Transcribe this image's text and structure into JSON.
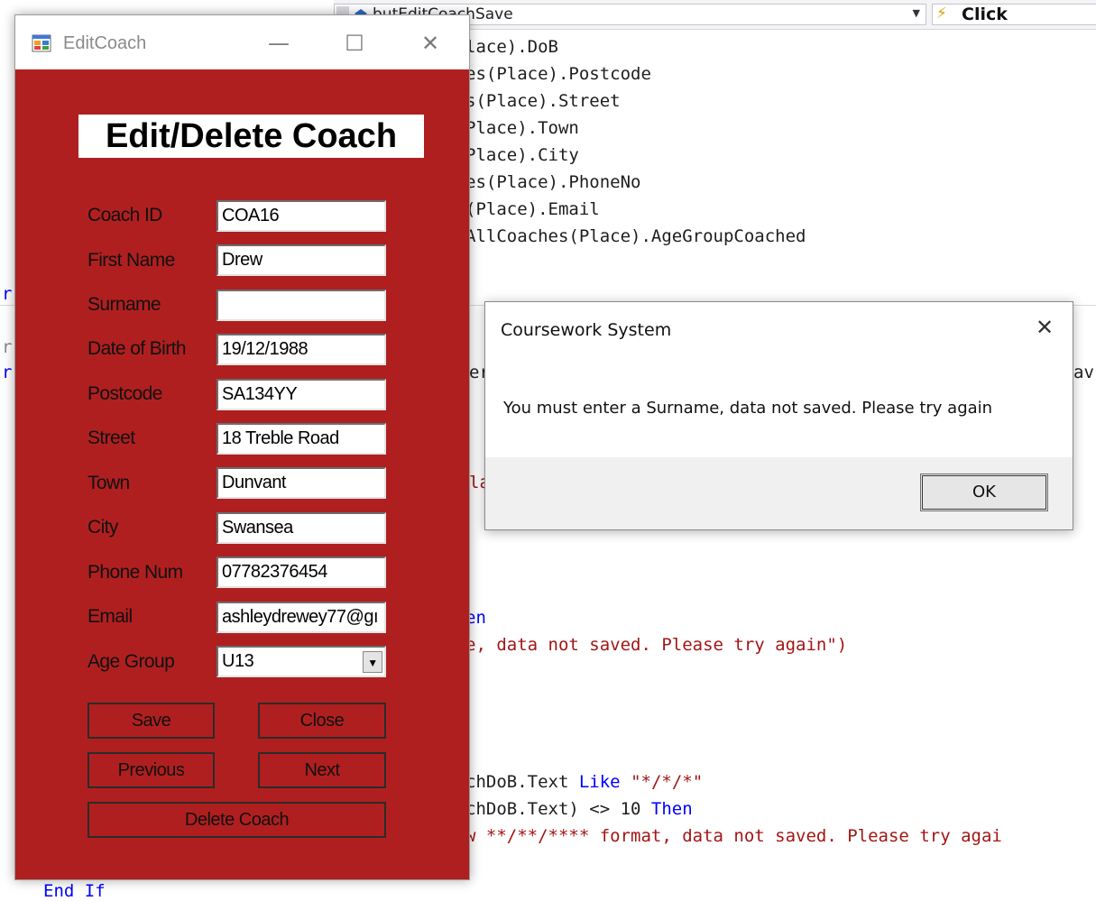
{
  "ide": {
    "method_combo": "butEditCoachSave",
    "event_combo": "Click",
    "code_lines_top": [
      "lace).DoB",
      "es(Place).Postcode",
      "s(Place).Street",
      "Place).Town",
      "Place).City",
      "es(Place).PhoneNo",
      "(Place).Email",
      "AllCoaches(Place).AgeGroupCoached"
    ],
    "code_fragments": {
      "left_r1": "r",
      "left_r2": "r",
      "left_r3": "r",
      "er": "er",
      "av": "av",
      "la": "la",
      "then_fragment": "en",
      "surname_msg_line": "e, data not saved. Please try again\")",
      "like_line_prefix": "chDoB.Text ",
      "like_kw": "Like",
      "like_str": "\"*/*/*\"",
      "len_line_prefix": "chDoB.Text) <> 10 ",
      "then_kw": "Then",
      "format_msg_line": "w **/**/**** format, data not saved. Please try agai",
      "end_if": "End If"
    }
  },
  "edit_coach": {
    "window_title": "EditCoach",
    "heading": "Edit/Delete Coach",
    "fields": {
      "coach_id": {
        "label": "Coach ID",
        "value": "COA16"
      },
      "first_name": {
        "label": "First Name",
        "value": "Drew"
      },
      "surname": {
        "label": "Surname",
        "value": ""
      },
      "dob": {
        "label": "Date of Birth",
        "value": "19/12/1988"
      },
      "postcode": {
        "label": "Postcode",
        "value": "SA134YY"
      },
      "street": {
        "label": "Street",
        "value": "18 Treble Road"
      },
      "town": {
        "label": "Town",
        "value": "Dunvant"
      },
      "city": {
        "label": "City",
        "value": "Swansea"
      },
      "phone": {
        "label": "Phone Num",
        "value": "07782376454"
      },
      "email": {
        "label": "Email",
        "value": "ashleydrewey77@gı"
      },
      "age_group": {
        "label": "Age Group",
        "value": "U13"
      }
    },
    "buttons": {
      "save": "Save",
      "close": "Close",
      "previous": "Previous",
      "next": "Next",
      "delete": "Delete Coach"
    },
    "colors": {
      "form_background": "#b01f1f"
    }
  },
  "message_box": {
    "title": "Coursework System",
    "message": "You must enter a Surname, data not saved. Please try again",
    "ok_label": "OK"
  }
}
